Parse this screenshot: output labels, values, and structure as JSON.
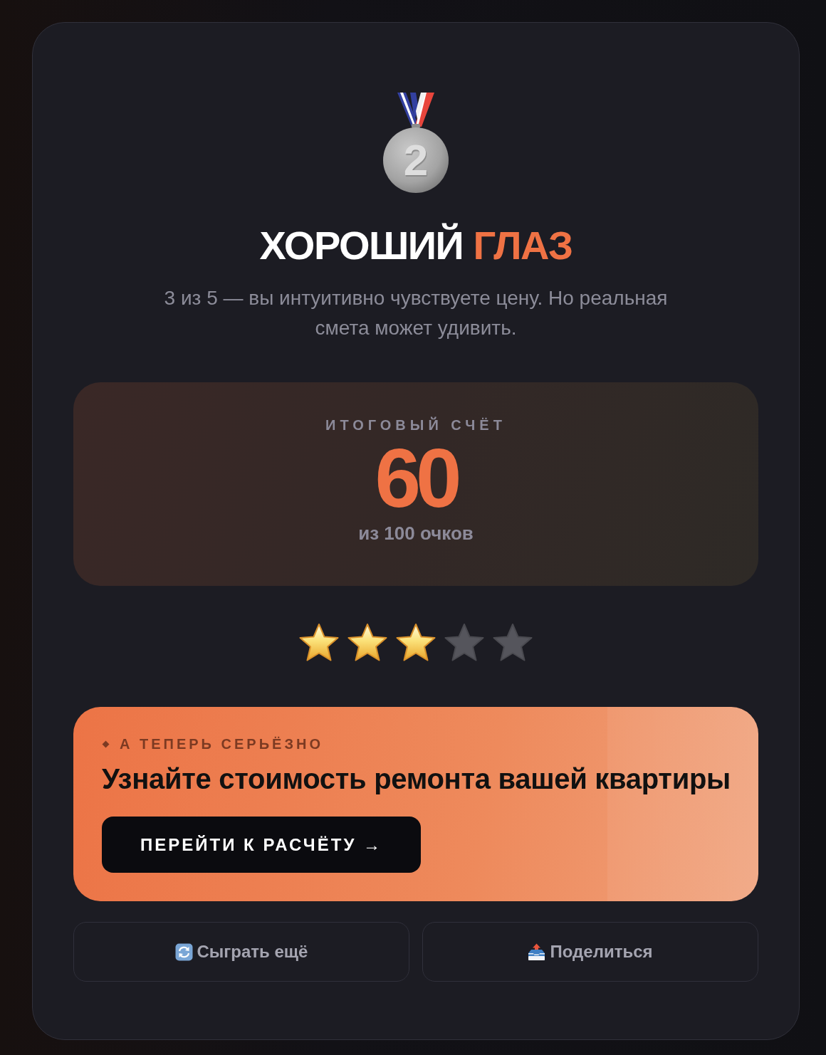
{
  "medal": {
    "number": "2"
  },
  "title": [
    {
      "text": "ХОРОШИЙ",
      "accent": false
    },
    {
      "text": "ГЛАЗ",
      "accent": true
    }
  ],
  "subtitle": "3 из 5 — вы интуитивно чувствуете цену. Но реальная смета может удивить.",
  "score": {
    "label": "ИТОГОВЫЙ СЧЁТ",
    "value": "60",
    "caption": "из 100 очков"
  },
  "rating": {
    "stars": 3
  },
  "promo": {
    "eyebrow": "А ТЕПЕРЬ СЕРЬЁЗНО",
    "heading": "Узнайте стоимость ремонта вашей квартиры",
    "button": "ПЕРЕЙТИ К РАСЧЁТУ →"
  },
  "actions": [
    {
      "kind": "replay",
      "label": "Сыграть ещё"
    },
    {
      "kind": "share",
      "label": "Поделиться"
    }
  ]
}
